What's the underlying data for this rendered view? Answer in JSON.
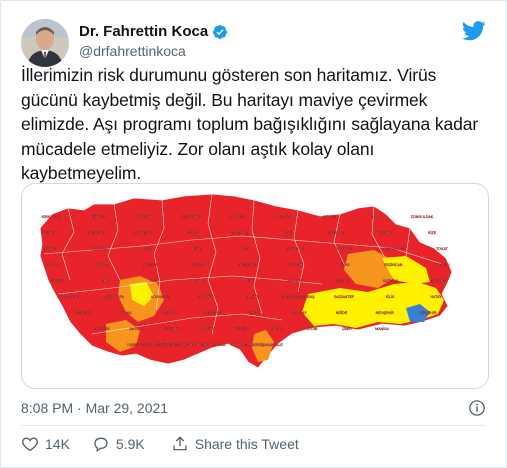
{
  "author": {
    "display_name": "Dr. Fahrettin Koca",
    "handle": "@drfahrettinkoca",
    "verified": true
  },
  "tweet": {
    "text": "İllerimizin risk durumunu gösteren son haritamız. Virüs\ngücünü kaybetmiş değil. Bu haritayı maviye çevirmek\nelimizde. Aşı programı toplum bağışıklığını sağlayana kadar\nmücadele etmeliyiz. Zor olanı aştık kolay olanı\nkaybetmeyelim.",
    "timestamp": "8:08 PM · Mar 29, 2021"
  },
  "actions": {
    "likes": "14K",
    "replies": "5.9K",
    "share_label": "Share this Tweet"
  },
  "map": {
    "legend_colors": {
      "very_high": "#e8242a",
      "high": "#f7941d",
      "medium": "#fff200",
      "low": "#3a7fd5"
    },
    "provinces": [
      "KIRKLARELİ",
      "EDİRNE",
      "İSTANBUL",
      "TEKİRDAĞ",
      "KOCAELİ",
      "SAKARYA",
      "DÜZCE",
      "BOLU",
      "ZONGULDAK",
      "BARTIN",
      "KARABÜK",
      "KASTAMONU",
      "SİNOP",
      "SAMSUN",
      "ORDU",
      "GİRESUN",
      "TRABZON",
      "RİZE",
      "ARTVİN",
      "ARDAHAN",
      "KARS",
      "IĞDIR",
      "AĞRI",
      "ERZURUM",
      "BAYBURT",
      "GÜMÜŞHANE",
      "TOKAT",
      "AMASYA",
      "ÇORUM",
      "ÇANKIRI",
      "ANKARA",
      "KIRIKKALE",
      "YOZGAT",
      "SİVAS",
      "ERZİNCAN",
      "TUNCELİ",
      "BİNGÖL",
      "MUŞ",
      "VAN",
      "BİTLİS",
      "SİİRT",
      "HAKKARİ",
      "ŞIRNAK",
      "BATMAN",
      "MARDİN",
      "DİYARBAKIR",
      "ŞANLIURFA",
      "ADIYAMAN",
      "MALATYA",
      "ELAZIĞ",
      "KAHRAMANMARAŞ",
      "GAZİANTEP",
      "KİLİS",
      "HATAY",
      "OSMANİYE",
      "ADANA",
      "MERSİN",
      "KARAMAN",
      "KONYA",
      "AKSARAY",
      "NİĞDE",
      "NEVŞEHİR",
      "KIRŞEHİR",
      "KAYSERİ",
      "ANTALYA",
      "BURDUR",
      "ISPARTA",
      "DENİZLİ",
      "MUĞLA",
      "AYDIN",
      "İZMİR",
      "MANİSA",
      "UŞAK",
      "AFYONKARAHİSAR",
      "KÜTAHYA",
      "ESKİŞEHİR",
      "BİLECİK",
      "BURSA",
      "YALOVA",
      "BALIKESİR",
      "ÇANAKKALE"
    ]
  }
}
